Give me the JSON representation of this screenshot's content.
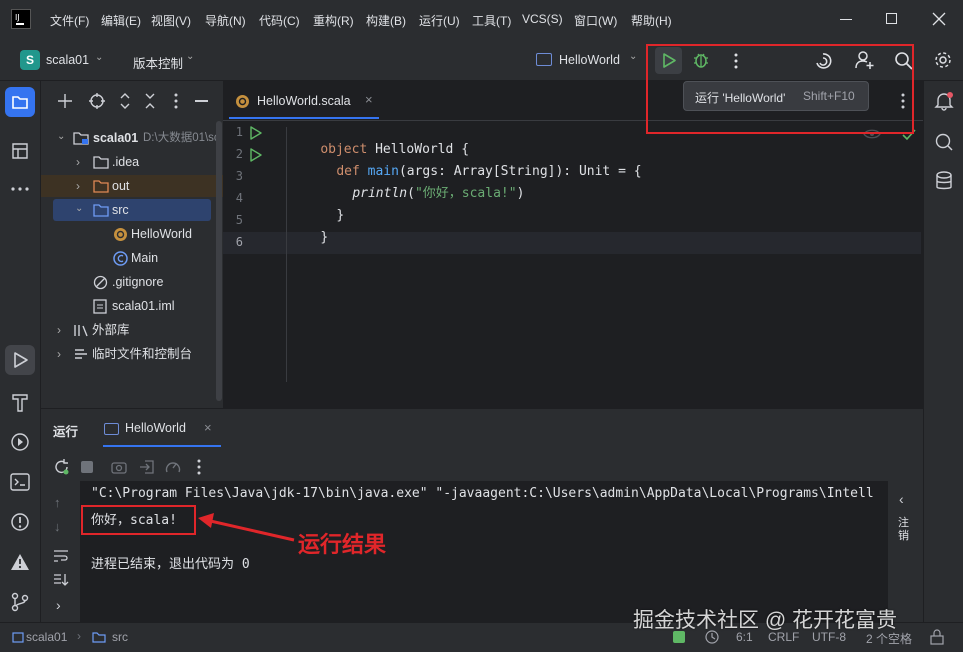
{
  "menubar": {
    "items": [
      "文件(F)",
      "编辑(E)",
      "视图(V)",
      "导航(N)",
      "代码(C)",
      "重构(R)",
      "构建(B)",
      "运行(U)",
      "工具(T)",
      "VCS(S)",
      "窗口(W)",
      "帮助(H)"
    ]
  },
  "toolbar": {
    "project_badge": "S",
    "project_name": "scala01",
    "vcs_label": "版本控制",
    "run_config": "HelloWorld",
    "tooltip_text": "运行 'HelloWorld'",
    "tooltip_shortcut": "Shift+F10"
  },
  "project_tree": {
    "root_name": "scala01",
    "root_path": "D:\\大数据01\\sc",
    "idea": ".idea",
    "out": "out",
    "src": "src",
    "helloworld": "HelloWorld",
    "main": "Main",
    "gitignore": ".gitignore",
    "iml": "scala01.iml",
    "external": "外部库",
    "scratches": "临时文件和控制台"
  },
  "editor": {
    "tab_label": "HelloWorld.scala",
    "line_numbers": [
      "1",
      "2",
      "3",
      "4",
      "5",
      "6"
    ],
    "lines": {
      "l1_kw": "object",
      "l1_rest": " HelloWorld {",
      "l2_kw": "def",
      "l2_fn": "main",
      "l2_rest": "(args: Array[String]): Unit = {",
      "l3_fn": "println",
      "l3_open": "(",
      "l3_str": "\"你好，scala!\"",
      "l3_close": ")",
      "l4": "}",
      "l5": "}"
    }
  },
  "run_panel": {
    "title": "运行",
    "tab_label": "HelloWorld",
    "console": {
      "line1": "\"C:\\Program Files\\Java\\jdk-17\\bin\\java.exe\" \"-javaagent:C:\\Users\\admin\\AppData\\Local\\Programs\\Intell",
      "line2": "你好，scala!",
      "line3": "进程已结束，退出代码为 0"
    },
    "annotation": "运行结果",
    "right_label": "注销"
  },
  "statusbar": {
    "crumb_project": "scala01",
    "crumb_src": "src",
    "position": "6:1",
    "line_ending": "CRLF",
    "encoding": "UTF-8",
    "indent": "2 个空格"
  },
  "watermark": "掘金技术社区 @ 花开花富贵",
  "colors": {
    "accent": "#3574f0",
    "run_green": "#5fb865",
    "annotation_red": "#e0262a"
  }
}
